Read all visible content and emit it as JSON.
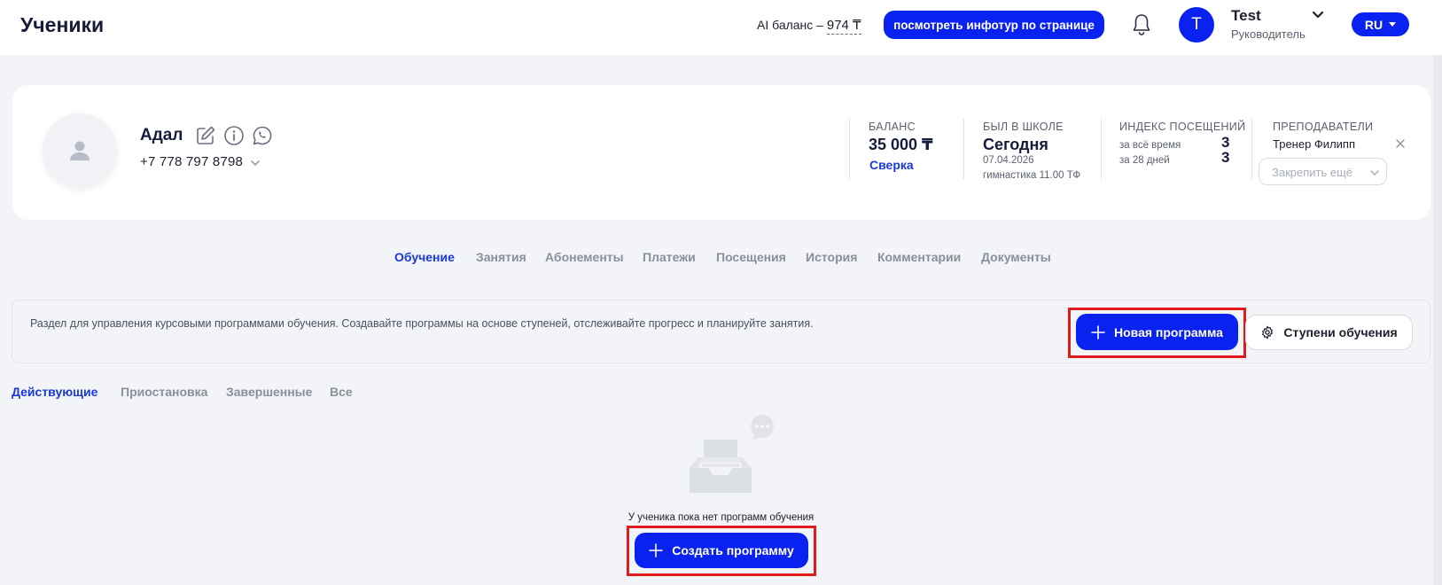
{
  "header": {
    "title": "Ученики",
    "ai_balance_label": "AI баланс –",
    "ai_balance_amount": "974 ₸",
    "tour_button": "посмотреть инфотур по странице",
    "user_initial": "T",
    "user_name": "Test",
    "user_role": "Руководитель",
    "language": "RU"
  },
  "student": {
    "name": "Адал",
    "phone": "+7 778 797 8798"
  },
  "stats": {
    "balance_label": "БАЛАНС",
    "balance_value": "35 000 ₸",
    "balance_link": "Сверка",
    "last_visit_label": "БЫЛ В ШКОЛЕ",
    "last_visit_value": "Сегодня",
    "last_visit_date": "07.04.2026",
    "last_visit_class": "гимнастика 11.00 ТФ",
    "attendance_label": "ИНДЕКС ПОСЕЩЕНИЙ",
    "attendance_all_label": "за всё время",
    "attendance_all_value": "3",
    "attendance_28_label": "за 28 дней",
    "attendance_28_value": "3",
    "teachers_label": "ПРЕПОДАВАТЕЛИ",
    "teacher_name": "Тренер Филипп",
    "pin_placeholder": "Закрепить ещё"
  },
  "tabs": [
    "Обучение",
    "Занятия",
    "Абонементы",
    "Платежи",
    "Посещения",
    "История",
    "Комментарии",
    "Документы"
  ],
  "info": {
    "text": "Раздел для управления курсовыми программами обучения. Создавайте программы на основе ступеней, отслеживайте прогресс и планируйте занятия.",
    "new_program_button": "Новая программа",
    "steps_button": "Ступени обучения"
  },
  "subtabs": [
    "Действующие",
    "Приостановка",
    "Завершенные",
    "Все"
  ],
  "empty": {
    "text": "У ученика пока нет программ обучения",
    "create_button": "Создать программу"
  },
  "colors": {
    "accent": "#0a22f0",
    "link": "#1a3ad8",
    "highlight": "#e11b1b"
  }
}
